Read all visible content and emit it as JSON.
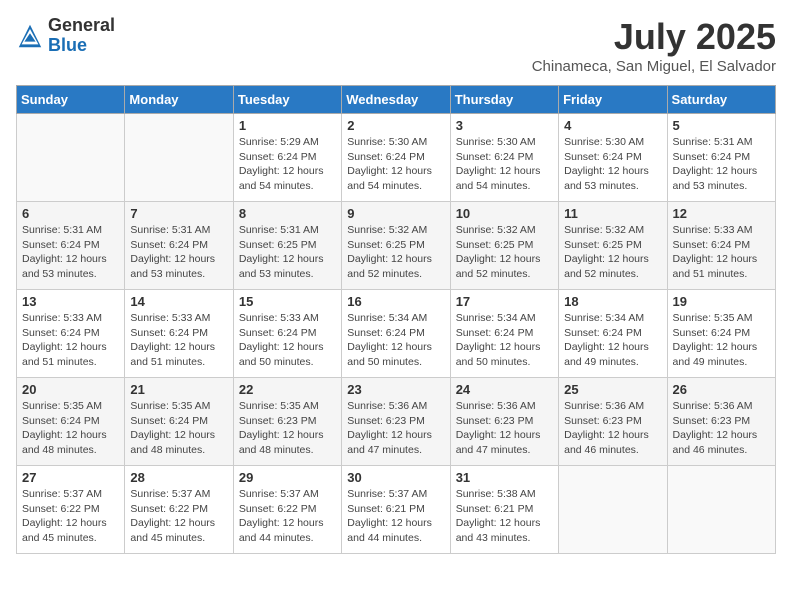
{
  "logo": {
    "general": "General",
    "blue": "Blue"
  },
  "title": {
    "month_year": "July 2025",
    "location": "Chinameca, San Miguel, El Salvador"
  },
  "days_of_week": [
    "Sunday",
    "Monday",
    "Tuesday",
    "Wednesday",
    "Thursday",
    "Friday",
    "Saturday"
  ],
  "weeks": [
    [
      {
        "day": "",
        "info": ""
      },
      {
        "day": "",
        "info": ""
      },
      {
        "day": "1",
        "info": "Sunrise: 5:29 AM\nSunset: 6:24 PM\nDaylight: 12 hours and 54 minutes."
      },
      {
        "day": "2",
        "info": "Sunrise: 5:30 AM\nSunset: 6:24 PM\nDaylight: 12 hours and 54 minutes."
      },
      {
        "day": "3",
        "info": "Sunrise: 5:30 AM\nSunset: 6:24 PM\nDaylight: 12 hours and 54 minutes."
      },
      {
        "day": "4",
        "info": "Sunrise: 5:30 AM\nSunset: 6:24 PM\nDaylight: 12 hours and 53 minutes."
      },
      {
        "day": "5",
        "info": "Sunrise: 5:31 AM\nSunset: 6:24 PM\nDaylight: 12 hours and 53 minutes."
      }
    ],
    [
      {
        "day": "6",
        "info": "Sunrise: 5:31 AM\nSunset: 6:24 PM\nDaylight: 12 hours and 53 minutes."
      },
      {
        "day": "7",
        "info": "Sunrise: 5:31 AM\nSunset: 6:24 PM\nDaylight: 12 hours and 53 minutes."
      },
      {
        "day": "8",
        "info": "Sunrise: 5:31 AM\nSunset: 6:25 PM\nDaylight: 12 hours and 53 minutes."
      },
      {
        "day": "9",
        "info": "Sunrise: 5:32 AM\nSunset: 6:25 PM\nDaylight: 12 hours and 52 minutes."
      },
      {
        "day": "10",
        "info": "Sunrise: 5:32 AM\nSunset: 6:25 PM\nDaylight: 12 hours and 52 minutes."
      },
      {
        "day": "11",
        "info": "Sunrise: 5:32 AM\nSunset: 6:25 PM\nDaylight: 12 hours and 52 minutes."
      },
      {
        "day": "12",
        "info": "Sunrise: 5:33 AM\nSunset: 6:24 PM\nDaylight: 12 hours and 51 minutes."
      }
    ],
    [
      {
        "day": "13",
        "info": "Sunrise: 5:33 AM\nSunset: 6:24 PM\nDaylight: 12 hours and 51 minutes."
      },
      {
        "day": "14",
        "info": "Sunrise: 5:33 AM\nSunset: 6:24 PM\nDaylight: 12 hours and 51 minutes."
      },
      {
        "day": "15",
        "info": "Sunrise: 5:33 AM\nSunset: 6:24 PM\nDaylight: 12 hours and 50 minutes."
      },
      {
        "day": "16",
        "info": "Sunrise: 5:34 AM\nSunset: 6:24 PM\nDaylight: 12 hours and 50 minutes."
      },
      {
        "day": "17",
        "info": "Sunrise: 5:34 AM\nSunset: 6:24 PM\nDaylight: 12 hours and 50 minutes."
      },
      {
        "day": "18",
        "info": "Sunrise: 5:34 AM\nSunset: 6:24 PM\nDaylight: 12 hours and 49 minutes."
      },
      {
        "day": "19",
        "info": "Sunrise: 5:35 AM\nSunset: 6:24 PM\nDaylight: 12 hours and 49 minutes."
      }
    ],
    [
      {
        "day": "20",
        "info": "Sunrise: 5:35 AM\nSunset: 6:24 PM\nDaylight: 12 hours and 48 minutes."
      },
      {
        "day": "21",
        "info": "Sunrise: 5:35 AM\nSunset: 6:24 PM\nDaylight: 12 hours and 48 minutes."
      },
      {
        "day": "22",
        "info": "Sunrise: 5:35 AM\nSunset: 6:23 PM\nDaylight: 12 hours and 48 minutes."
      },
      {
        "day": "23",
        "info": "Sunrise: 5:36 AM\nSunset: 6:23 PM\nDaylight: 12 hours and 47 minutes."
      },
      {
        "day": "24",
        "info": "Sunrise: 5:36 AM\nSunset: 6:23 PM\nDaylight: 12 hours and 47 minutes."
      },
      {
        "day": "25",
        "info": "Sunrise: 5:36 AM\nSunset: 6:23 PM\nDaylight: 12 hours and 46 minutes."
      },
      {
        "day": "26",
        "info": "Sunrise: 5:36 AM\nSunset: 6:23 PM\nDaylight: 12 hours and 46 minutes."
      }
    ],
    [
      {
        "day": "27",
        "info": "Sunrise: 5:37 AM\nSunset: 6:22 PM\nDaylight: 12 hours and 45 minutes."
      },
      {
        "day": "28",
        "info": "Sunrise: 5:37 AM\nSunset: 6:22 PM\nDaylight: 12 hours and 45 minutes."
      },
      {
        "day": "29",
        "info": "Sunrise: 5:37 AM\nSunset: 6:22 PM\nDaylight: 12 hours and 44 minutes."
      },
      {
        "day": "30",
        "info": "Sunrise: 5:37 AM\nSunset: 6:21 PM\nDaylight: 12 hours and 44 minutes."
      },
      {
        "day": "31",
        "info": "Sunrise: 5:38 AM\nSunset: 6:21 PM\nDaylight: 12 hours and 43 minutes."
      },
      {
        "day": "",
        "info": ""
      },
      {
        "day": "",
        "info": ""
      }
    ]
  ]
}
